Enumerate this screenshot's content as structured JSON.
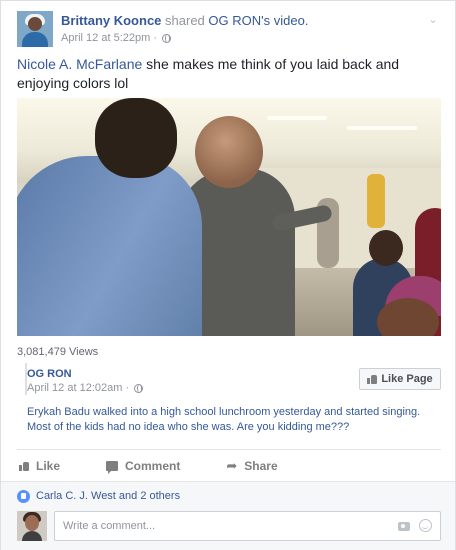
{
  "post": {
    "author": "Brittany Koonce",
    "shared_text": "shared",
    "source": "OG RON",
    "source_suffix": "'s video.",
    "timestamp": "April 12 at 5:22pm · ",
    "menu_icon": "chevron-down-icon"
  },
  "message": {
    "mention": "Nicole A. McFarlane",
    "text": " she makes me think of you laid back and enjoying colors lol"
  },
  "video": {
    "views": "3,081,479 Views"
  },
  "page": {
    "name": "OG RON",
    "timestamp": "April 12 at 12:02am · ",
    "like_button": "Like Page",
    "description": "Erykah Badu walked into a high school lunchroom yesterday and started singing. Most of the kids had no idea who she was. Are you kidding me???"
  },
  "actions": {
    "like": "Like",
    "comment": "Comment",
    "share": "Share"
  },
  "social": {
    "likers": "Carla C. J. West and 2 others",
    "comment_placeholder": "Write a comment..."
  },
  "colors": {
    "link": "#365899",
    "meta": "#90949c",
    "like_badge": "#5890ff"
  }
}
